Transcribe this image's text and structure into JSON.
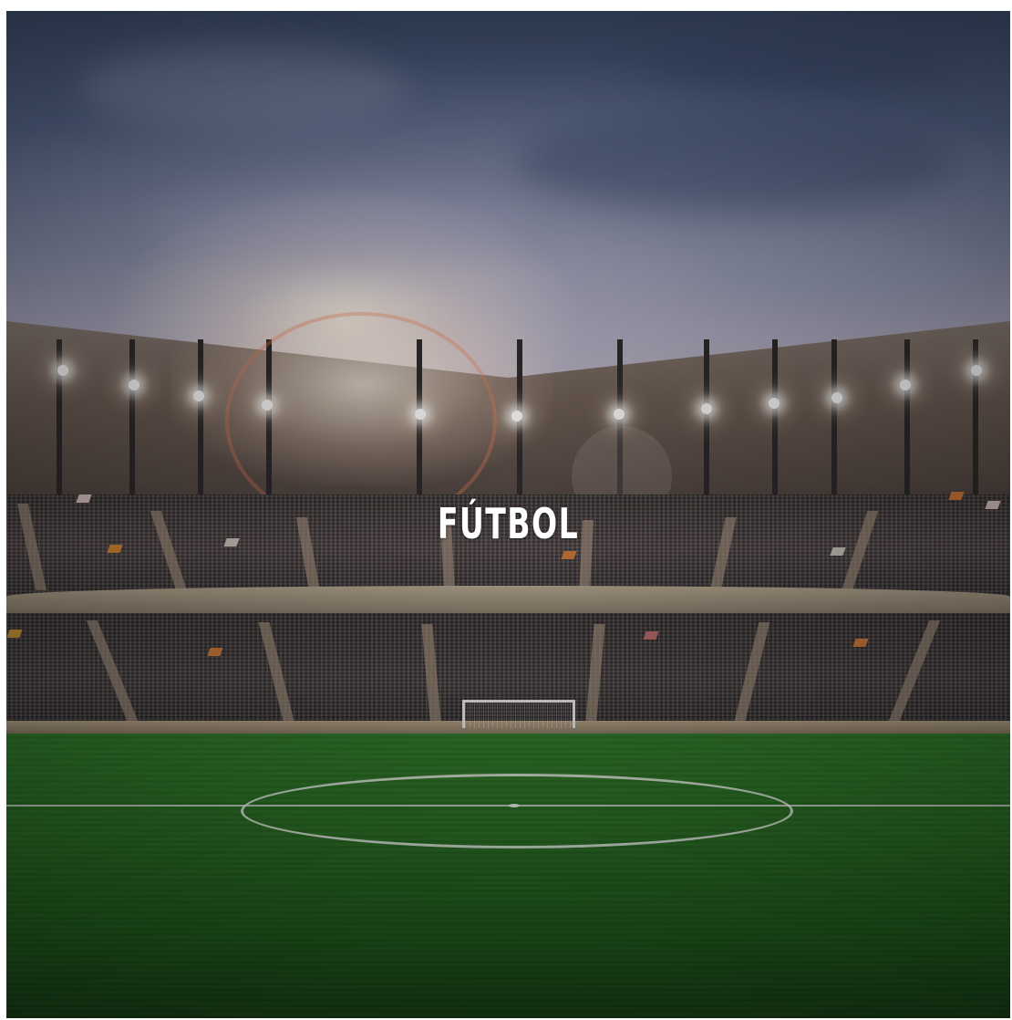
{
  "tile": {
    "title": "FÚTBOL",
    "background_scene": "stadium-at-night"
  },
  "colors": {
    "title": "#ffffff",
    "pitch": "#2a6d24",
    "sky": "#56678a"
  }
}
